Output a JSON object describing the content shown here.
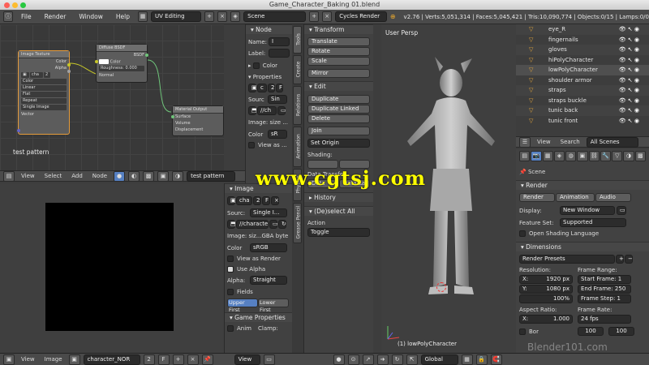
{
  "window": {
    "title": "Game_Character_Baking 01.blend"
  },
  "topbar": {
    "menus": [
      "File",
      "Render",
      "Window",
      "Help"
    ],
    "layout": "UV Editing",
    "scene": "Scene",
    "engine": "Cycles Render",
    "stats": "v2.76 | Verts:5,051,314 | Faces:5,045,421 | Tris:10,090,774 | Objects:0/15 | Lamps:0/0"
  },
  "node_editor": {
    "image_texture_node": {
      "title": "Image Texture",
      "outputs": [
        "Color",
        "Alpha"
      ],
      "image": "cha",
      "image_users": "2",
      "color": "Color",
      "interp": "Linear",
      "proj": "Flat",
      "ext": "Repeat",
      "source": "Single Image",
      "input": "Vector"
    },
    "diffuse_node": {
      "title": "Diffuse BSDF",
      "output": "BSDF",
      "color_label": "Color",
      "roughness": "Roughness: 0.000",
      "input": "Normal"
    },
    "output_node": {
      "title": "Material Output",
      "inputs": [
        "Surface",
        "Volume",
        "Displacement"
      ]
    },
    "caption": "test pattern",
    "header": {
      "menus": [
        "View",
        "Select",
        "Add",
        "Node"
      ],
      "material": "test pattern"
    }
  },
  "node_panel": {
    "node_header": "Node",
    "name_label": "Name:",
    "name_value": "I",
    "label_label": "Label:",
    "color_header": "Color",
    "properties_header": "Properties",
    "prop_image": "c",
    "prop_users": "2",
    "prop_f": "F",
    "source_label": "Sourc",
    "source_value": "Sin",
    "path": "//ch",
    "image_size": "Image: size ...",
    "color_label": "Color",
    "color_value": "sR",
    "view_as": "View as ..."
  },
  "image_panel": {
    "header": "Image",
    "image": "cha",
    "users": "2",
    "fake": "F",
    "source_label": "Sourc:",
    "source_value": "Single I...",
    "path": "//characte",
    "image_info": "Image: siz...GBA byte",
    "color_label": "Color",
    "color_value": "sRGB",
    "view_as_render": "View as Render",
    "use_alpha": "Use Alpha",
    "alpha_label": "Alpha:",
    "alpha_value": "Straight",
    "fields": "Fields",
    "upper_first": "Upper First",
    "lower_first": "Lower First",
    "game_props": "Game Properties",
    "anim": "Anim",
    "clamp": "Clamp:"
  },
  "tool_tabs": [
    "Tools",
    "Create",
    "Relations",
    "Animation",
    "Physics",
    "Grease Pencil"
  ],
  "tools": {
    "transform_header": "Transform",
    "translate": "Translate",
    "rotate": "Rotate",
    "scale": "Scale",
    "mirror": "Mirror",
    "edit_header": "Edit",
    "duplicate": "Duplicate",
    "duplicate_linked": "Duplicate Linked",
    "delete": "Delete",
    "join": "Join",
    "set_origin": "Set Origin",
    "shading": "Shading:",
    "data_transfer": "Data Transfer",
    "data": "Data",
    "data_layers": "Data La",
    "history": "History",
    "deselect_all": "(De)select All",
    "action_label": "Action",
    "action_value": "Toggle"
  },
  "viewport": {
    "view": "User Persp",
    "object": "(1) lowPolyCharacter"
  },
  "outliner": {
    "items": [
      "eye_R",
      "fingernails",
      "gloves",
      "hiPolyCharacter",
      "lowPolyCharacter",
      "shoulder armor",
      "straps",
      "straps buckle",
      "tunic back",
      "tunic front"
    ],
    "view": "View",
    "search": "Search",
    "scope": "All Scenes"
  },
  "properties": {
    "scene": "Scene",
    "render_header": "Render",
    "render_btn": "Render",
    "animation_btn": "Animation",
    "audio_btn": "Audio",
    "display_label": "Display:",
    "display_value": "New Window",
    "feature_label": "Feature Set:",
    "feature_value": "Supported",
    "osl": "Open Shading Language",
    "dimensions_header": "Dimensions",
    "presets": "Render Presets",
    "resolution_label": "Resolution:",
    "res_x": "X:",
    "res_x_value": "1920 px",
    "res_y": "Y:",
    "res_y_value": "1080 px",
    "res_pct": "100%",
    "frame_range_label": "Frame Range:",
    "start": "Start Frame: 1",
    "end": "End Frame: 250",
    "step": "Frame Step: 1",
    "aspect_label": "Aspect Ratio:",
    "aspect_x": "X:",
    "aspect_x_value": "1.000",
    "frame_rate_label": "Frame Rate:",
    "fps": "24 fps",
    "bor": "Bor",
    "time_old": "100",
    "time_new": "100"
  },
  "bottom_bar": {
    "menus": [
      "View",
      "Image"
    ],
    "image": "character_NOR",
    "users": "2",
    "fake": "F",
    "view": "View",
    "orientation": "Global"
  },
  "watermark": "www.cgtsj.com",
  "watermark2": "Blender101.com",
  "colors": {
    "accent": "#5680c2",
    "watermark": "#ffff00",
    "node_link": "#c7c729"
  }
}
